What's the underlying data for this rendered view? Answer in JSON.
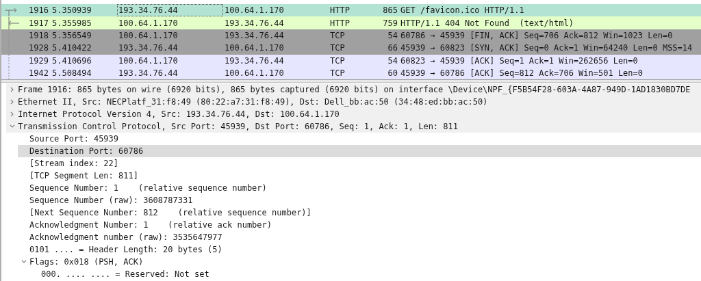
{
  "packet_list": {
    "rows": [
      {
        "no": "1916",
        "time": "5.350939",
        "source": "193.34.76.44",
        "destination": "100.64.1.170",
        "protocol": "HTTP",
        "length": "865",
        "info": "GET /favicon.ico HTTP/1.1",
        "color": "#b3e3d3",
        "selected": true,
        "kind": "request"
      },
      {
        "no": "1917",
        "time": "5.355985",
        "source": "100.64.1.170",
        "destination": "193.34.76.44",
        "protocol": "HTTP",
        "length": "759",
        "info": "HTTP/1.1 404 Not Found  (text/html)",
        "color": "#e4ffc7",
        "selected": false,
        "kind": "response"
      },
      {
        "no": "1918",
        "time": "5.356549",
        "source": "100.64.1.170",
        "destination": "193.34.76.44",
        "protocol": "TCP",
        "length": "54",
        "info": "60786 → 45939 [FIN, ACK] Seq=706 Ack=812 Win=1023 Len=0",
        "color": "#a0a0a0",
        "selected": false,
        "kind": "conversation"
      },
      {
        "no": "1928",
        "time": "5.410422",
        "source": "193.34.76.44",
        "destination": "100.64.1.170",
        "protocol": "TCP",
        "length": "66",
        "info": "45939 → 60823 [SYN, ACK] Seq=0 Ack=1 Win=64240 Len=0 MSS=14",
        "color": "#a0a0a0",
        "selected": false,
        "kind": "conversation"
      },
      {
        "no": "1929",
        "time": "5.410696",
        "source": "100.64.1.170",
        "destination": "193.34.76.44",
        "protocol": "TCP",
        "length": "54",
        "info": "60823 → 45939 [ACK] Seq=1 Ack=1 Win=262656 Len=0",
        "color": "#e7e6ff",
        "selected": false,
        "kind": "conversation"
      },
      {
        "no": "1942",
        "time": "5.508494",
        "source": "193.34.76.44",
        "destination": "100.64.1.170",
        "protocol": "TCP",
        "length": "60",
        "info": "45939 → 60786 [ACK] Seq=812 Ack=706 Win=501 Len=0",
        "color": "#e7e6ff",
        "selected": false,
        "kind": "conversation"
      }
    ]
  },
  "packet_details": {
    "items": [
      {
        "text": "Frame 1916: 865 bytes on wire (6920 bits), 865 bytes captured (6920 bits) on interface \\Device\\NPF_{F5B54F28-603A-4A87-949D-1AD1830BD7DE",
        "kind": "branch",
        "expanded": false,
        "selected": false
      },
      {
        "text": "Ethernet II, Src: NECPlatf_31:f8:49 (80:22:a7:31:f8:49), Dst: Dell_bb:ac:50 (34:48:ed:bb:ac:50)",
        "kind": "branch",
        "expanded": false,
        "selected": false
      },
      {
        "text": "Internet Protocol Version 4, Src: 193.34.76.44, Dst: 100.64.1.170",
        "kind": "branch",
        "expanded": false,
        "selected": false
      },
      {
        "text": "Transmission Control Protocol, Src Port: 45939, Dst Port: 60786, Seq: 1, Ack: 1, Len: 811",
        "kind": "branch",
        "expanded": true,
        "selected": false,
        "children": [
          {
            "text": "Source Port: 45939",
            "kind": "leaf",
            "selected": false
          },
          {
            "text": "Destination Port: 60786",
            "kind": "leaf",
            "selected": true
          },
          {
            "text": "[Stream index: 22]",
            "kind": "leaf",
            "selected": false
          },
          {
            "text": "[TCP Segment Len: 811]",
            "kind": "leaf",
            "selected": false
          },
          {
            "text": "Sequence Number: 1    (relative sequence number)",
            "kind": "leaf",
            "selected": false
          },
          {
            "text": "Sequence Number (raw): 3608787331",
            "kind": "leaf",
            "selected": false
          },
          {
            "text": "[Next Sequence Number: 812    (relative sequence number)]",
            "kind": "leaf",
            "selected": false
          },
          {
            "text": "Acknowledgment Number: 1    (relative ack number)",
            "kind": "leaf",
            "selected": false
          },
          {
            "text": "Acknowledgment number (raw): 3535647977",
            "kind": "leaf",
            "selected": false
          },
          {
            "text": "0101 .... = Header Length: 20 bytes (5)",
            "kind": "leaf",
            "selected": false
          },
          {
            "text": "Flags: 0x018 (PSH, ACK)",
            "kind": "branch",
            "expanded": true,
            "selected": false,
            "children": [
              {
                "text": "000. .... .... = Reserved: Not set",
                "kind": "leaf",
                "selected": false
              }
            ]
          }
        ]
      }
    ]
  }
}
